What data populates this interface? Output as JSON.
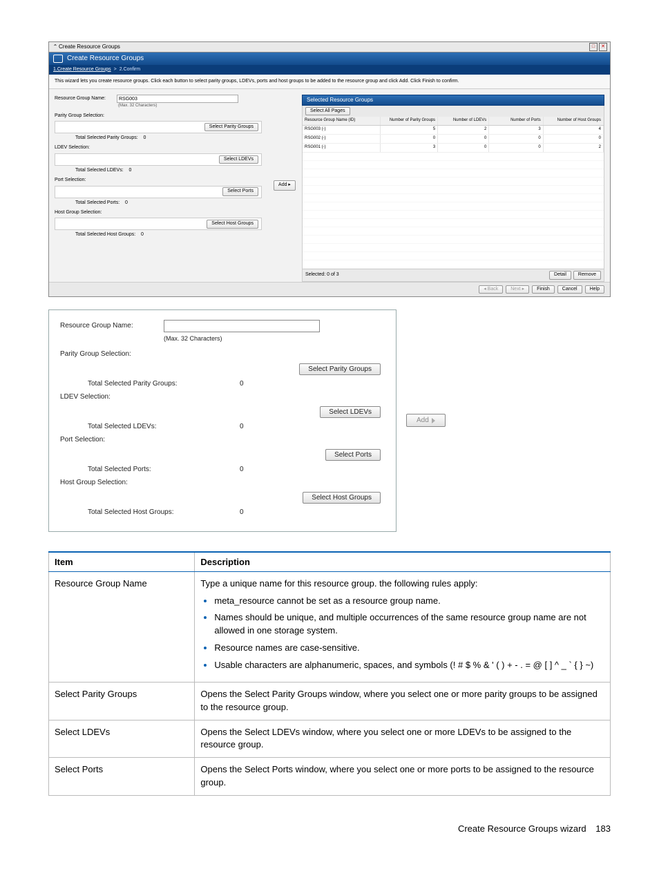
{
  "wizard": {
    "title": "Create Resource Groups",
    "band_title": "Create Resource Groups",
    "crumb1": "1.Create Resource Groups",
    "crumb_sep": ">",
    "crumb2": "2.Confirm",
    "description": "This wizard lets you create resource groups. Click each button to select parity groups, LDEVs, ports and host groups to be added to the resource group and click Add. Click Finish to confirm.",
    "left": {
      "name_label": "Resource Group Name:",
      "name_value": "RSG003",
      "name_hint": "(Max. 32 Characters)",
      "parity_header": "Parity Group Selection:",
      "parity_btn": "Select Parity Groups",
      "parity_total_label": "Total Selected Parity Groups:",
      "parity_total_value": "0",
      "ldev_header": "LDEV Selection:",
      "ldev_btn": "Select LDEVs",
      "ldev_total_label": "Total Selected LDEVs:",
      "ldev_total_value": "0",
      "port_header": "Port Selection:",
      "port_btn": "Select Ports",
      "port_total_label": "Total Selected Ports:",
      "port_total_value": "0",
      "hg_header": "Host Group Selection:",
      "hg_btn": "Select Host Groups",
      "hg_total_label": "Total Selected Host Groups:",
      "hg_total_value": "0"
    },
    "add_btn": "Add ▸",
    "right": {
      "title": "Selected Resource Groups",
      "select_all_btn": "Select All Pages",
      "col1": "Resource Group Name (ID)",
      "col2": "Number of Parity Groups",
      "col3": "Number of LDEVs",
      "col4": "Number of Ports",
      "col5": "Number of Host Groups",
      "rows": [
        {
          "name": "RSG003 (-)",
          "pg": "5",
          "ld": "2",
          "po": "3",
          "hg": "4"
        },
        {
          "name": "RSG002 (-)",
          "pg": "0",
          "ld": "0",
          "po": "0",
          "hg": "0"
        },
        {
          "name": "RSG001 (-)",
          "pg": "3",
          "ld": "0",
          "po": "0",
          "hg": "2"
        }
      ],
      "selected_label": "Selected:  0  of  3",
      "detail_btn": "Detail",
      "remove_btn": "Remove"
    },
    "footer": {
      "back": "◂ Back",
      "next": "Next ▸",
      "finish": "Finish",
      "cancel": "Cancel",
      "help": "Help"
    }
  },
  "zoom": {
    "name_label": "Resource Group Name:",
    "name_hint": "(Max. 32 Characters)",
    "parity_header": "Parity Group Selection:",
    "parity_btn": "Select Parity Groups",
    "parity_total_label": "Total Selected Parity Groups:",
    "parity_total_value": "0",
    "ldev_header": "LDEV Selection:",
    "ldev_btn": "Select LDEVs",
    "ldev_total_label": "Total Selected LDEVs:",
    "ldev_total_value": "0",
    "port_header": "Port Selection:",
    "port_btn": "Select Ports",
    "port_total_label": "Total Selected Ports:",
    "port_total_value": "0",
    "hg_header": "Host Group Selection:",
    "hg_btn": "Select Host Groups",
    "hg_total_label": "Total Selected Host Groups:",
    "hg_total_value": "0",
    "add_btn": "Add"
  },
  "doc_table": {
    "h_item": "Item",
    "h_desc": "Description",
    "rows": [
      {
        "item": "Resource Group Name",
        "lead": "Type a unique name for this resource group. the following rules apply:",
        "bullets": [
          "meta_resource cannot be set as a resource group name.",
          "Names should be unique, and multiple occurrences of the same resource group name are not allowed in one storage system.",
          "Resource names are case-sensitive.",
          "Usable characters are alphanumeric, spaces, and symbols (! # $ % & ' ( ) + - . = @ [ ] ^ _ ` { } ~)"
        ]
      },
      {
        "item": "Select Parity Groups",
        "lead": "Opens the Select Parity Groups window, where you select one or more parity groups to be assigned to the resource group."
      },
      {
        "item": "Select LDEVs",
        "lead": "Opens the Select LDEVs window, where you select one or more LDEVs to be assigned to the resource group."
      },
      {
        "item": "Select Ports",
        "lead": "Opens the Select Ports window, where you select one or more ports to be assigned to the resource group."
      }
    ]
  },
  "footer": {
    "text": "Create Resource Groups wizard",
    "page": "183"
  }
}
